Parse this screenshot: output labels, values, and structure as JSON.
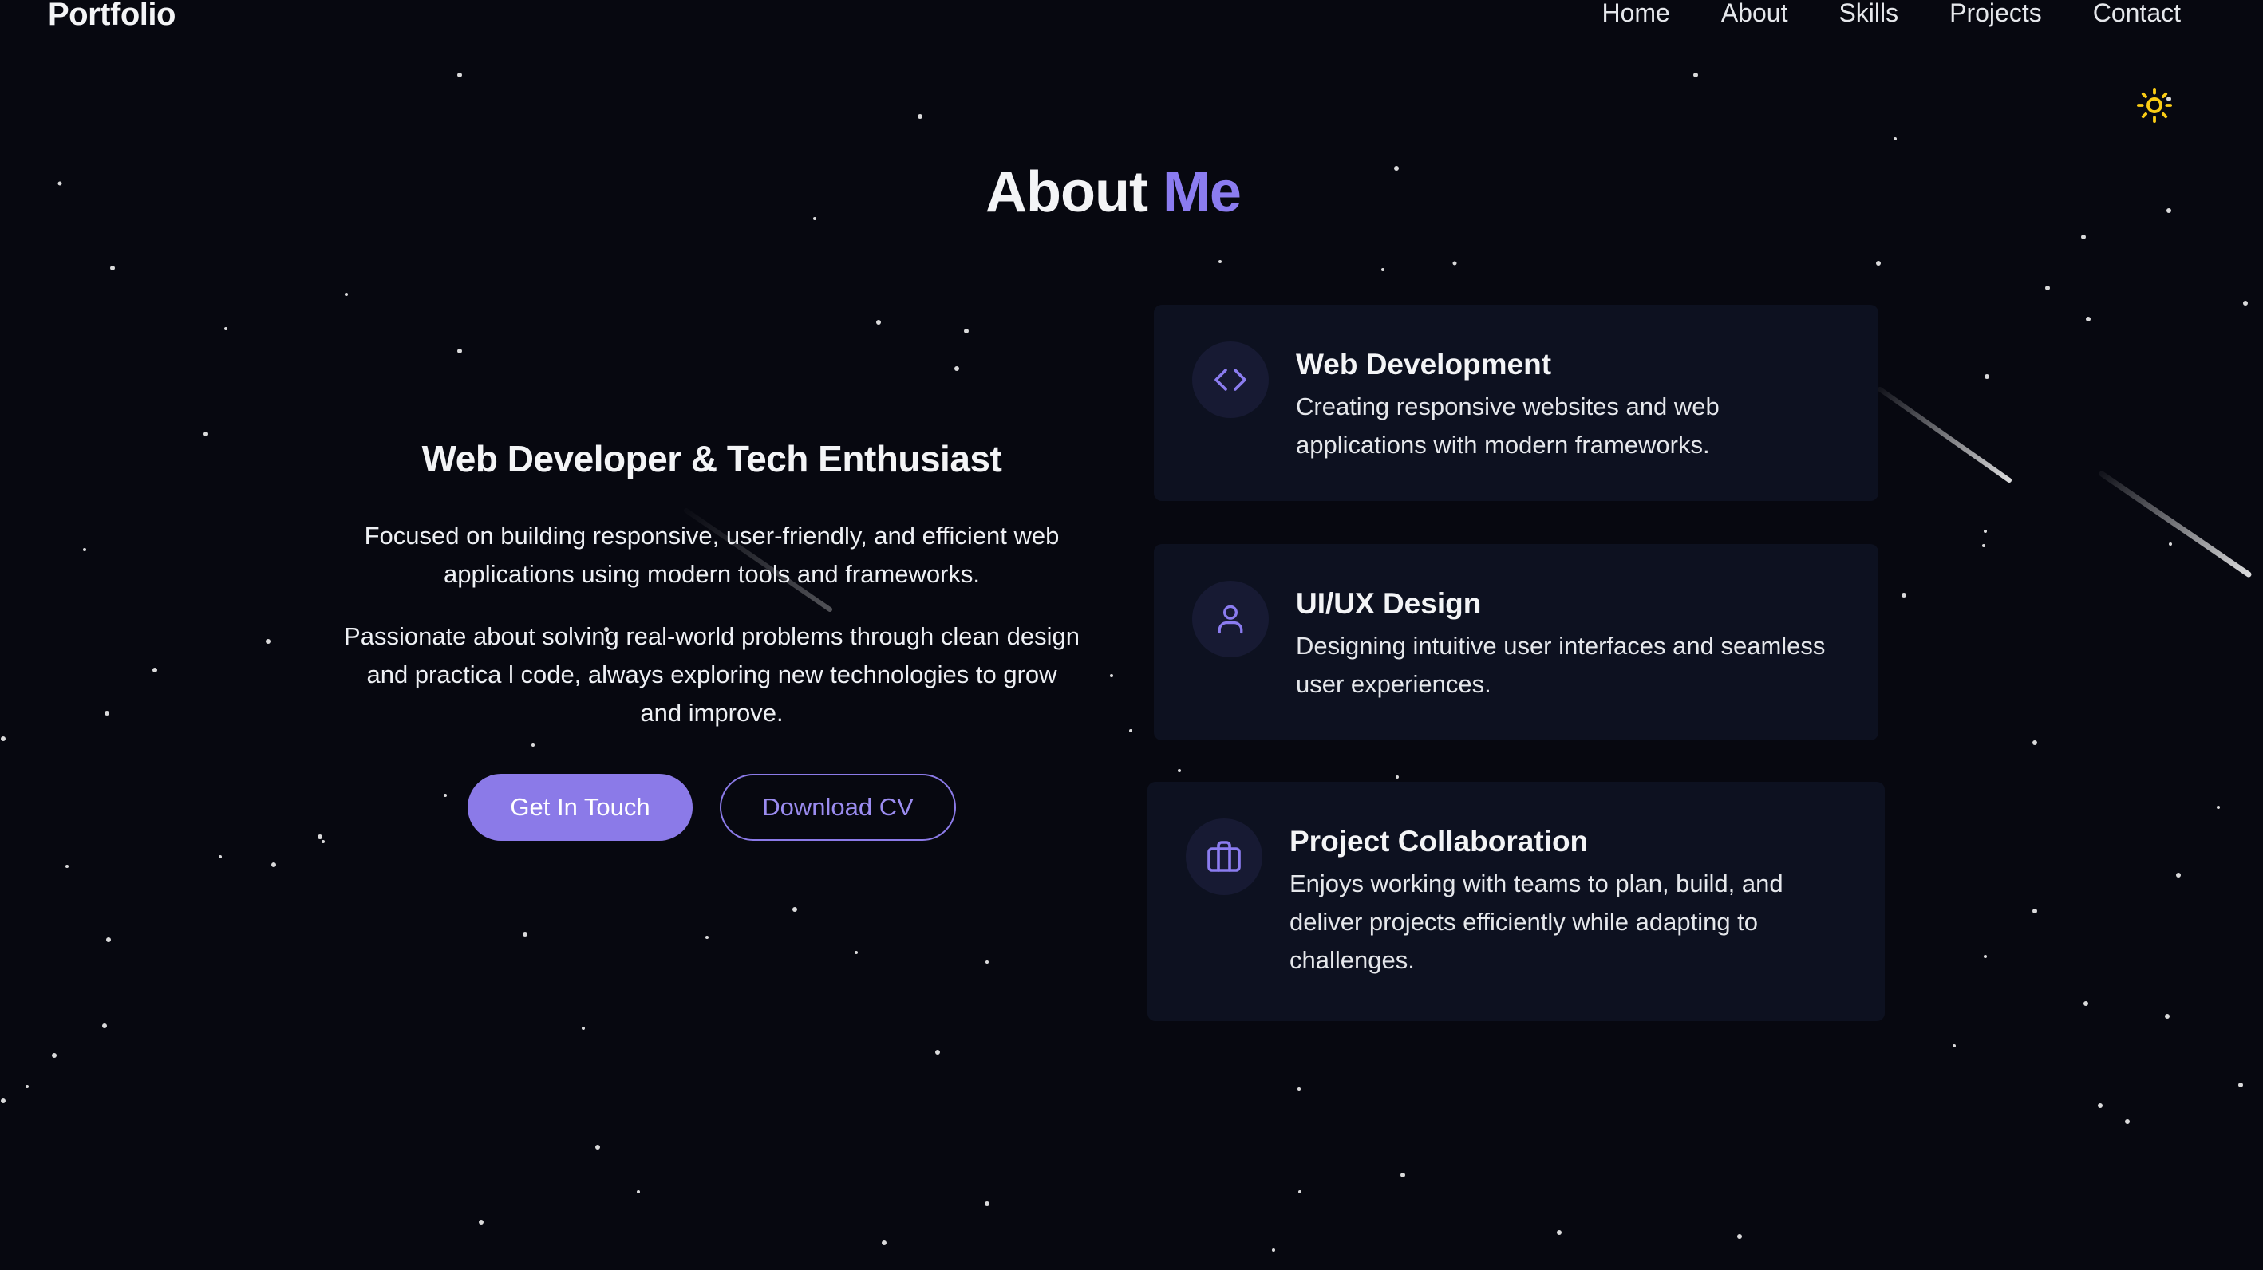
{
  "header": {
    "logo": "Portfolio",
    "nav": [
      "Home",
      "About",
      "Skills",
      "Projects",
      "Contact"
    ],
    "theme_icon": "sun-icon"
  },
  "about": {
    "title_main": "About",
    "title_accent": "Me",
    "subtitle": "Web Developer & Tech Enthusiast",
    "paragraph1": "Focused on building responsive, user-friendly, and efficient web applications using modern tools and frameworks.",
    "paragraph2": "Passionate about solving real-world problems through clean design and practica l code, always exploring new technologies to grow and improve.",
    "primary_button": "Get In Touch",
    "secondary_button": "Download CV"
  },
  "cards": [
    {
      "icon": "code-icon",
      "title": "Web Development",
      "description": "Creating responsive websites and web applications with modern frameworks."
    },
    {
      "icon": "user-icon",
      "title": "UI/UX Design",
      "description": "Designing intuitive user interfaces and seamless user experiences."
    },
    {
      "icon": "briefcase-icon",
      "title": "Project Collaboration",
      "description": "Enjoys working with teams to plan, build, and deliver projects efficiently while adapting to challenges."
    }
  ],
  "colors": {
    "background": "#070810",
    "accent": "#8b7ae8",
    "card": "#0d1120",
    "sun": "#facc15"
  }
}
